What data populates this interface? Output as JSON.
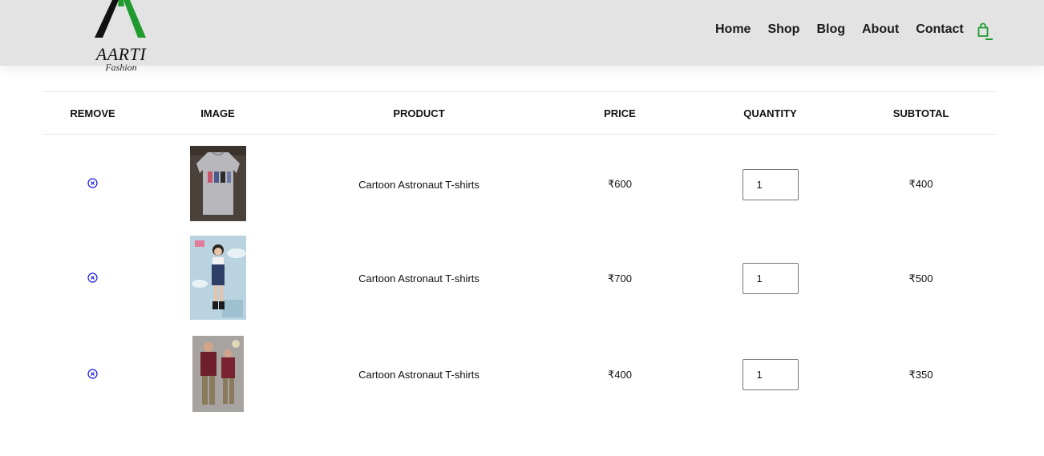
{
  "brand": {
    "name": "AARTI",
    "tagline": "Fashion"
  },
  "nav": {
    "items": [
      "Home",
      "Shop",
      "Blog",
      "About",
      "Contact"
    ],
    "cart_icon": "shopping-bag-icon"
  },
  "colors": {
    "header_bg": "#e3e3e3",
    "accent": "#1f9a2f",
    "remove_icon": "#1a1adb"
  },
  "table": {
    "headers": {
      "remove": "REMOVE",
      "image": "IMAGE",
      "product": "PRODUCT",
      "price": "PRICE",
      "quantity": "QUANTITY",
      "subtotal": "SUBTOTAL"
    },
    "rows": [
      {
        "product": "Cartoon Astronaut T-shirts",
        "price": "₹600",
        "quantity": "1",
        "subtotal": "₹400",
        "image": "grey sweatshirt with astronaut print"
      },
      {
        "product": "Cartoon Astronaut T-shirts",
        "price": "₹700",
        "quantity": "1",
        "subtotal": "₹500",
        "image": "girl in denim dungaree"
      },
      {
        "product": "Cartoon Astronaut T-shirts",
        "price": "₹400",
        "quantity": "1",
        "subtotal": "₹350",
        "image": "two boys in maroon shirts"
      }
    ]
  }
}
